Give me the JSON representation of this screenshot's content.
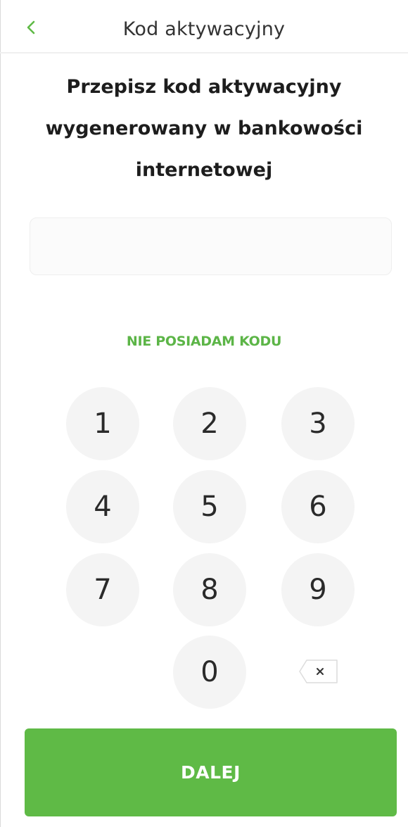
{
  "header": {
    "back_icon": "chevron-left-icon",
    "title": "Kod aktywacyjny"
  },
  "instruction": {
    "line1": "Przepisz kod aktywacyjny",
    "line2": "wygenerowany w bankowości",
    "line3": "internetowej"
  },
  "code_input": {
    "value": "",
    "placeholder": ""
  },
  "no_code_link": "NIE POSIADAM KODU",
  "keypad": {
    "keys": [
      "1",
      "2",
      "3",
      "4",
      "5",
      "6",
      "7",
      "8",
      "9",
      "0"
    ],
    "backspace_icon": "backspace-icon"
  },
  "next_button": "DALEJ",
  "colors": {
    "accent": "#5fba46",
    "link": "#5cb547",
    "key_background": "#f4f4f4"
  }
}
